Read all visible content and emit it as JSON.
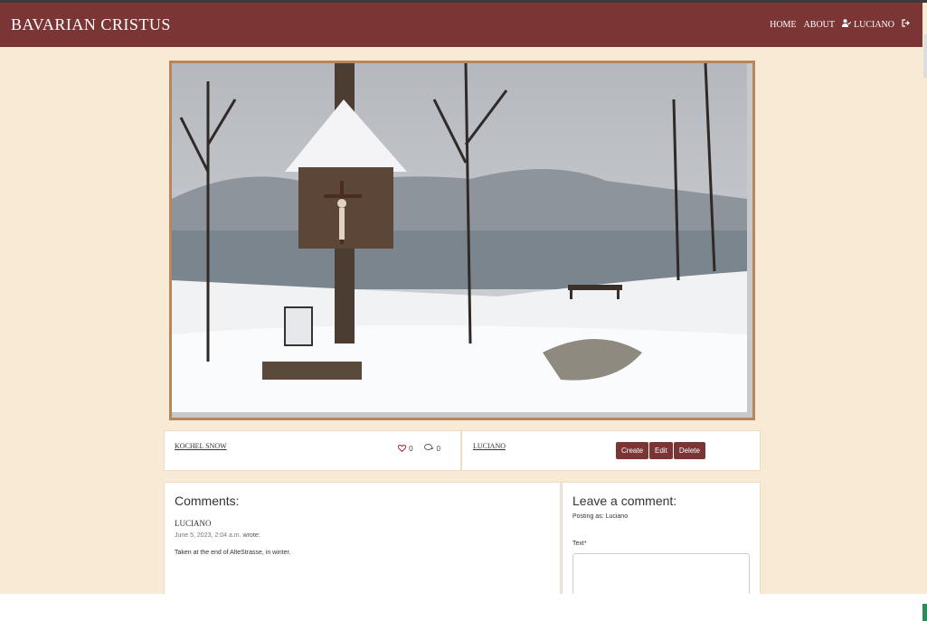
{
  "brand": "Bavarian Cristus",
  "nav": {
    "home": "Home",
    "about": "About",
    "user": "Luciano"
  },
  "post": {
    "title": "Kochel Snow",
    "likes": "0",
    "comments_count": "0",
    "author": "Luciano",
    "buttons": {
      "create": "Create",
      "edit": "Edit",
      "delete": "Delete"
    }
  },
  "comments": {
    "heading": "Comments:",
    "items": [
      {
        "author": "Luciano",
        "date": "June 5, 2023, 2:04 a.m.",
        "wrote": "wrote:",
        "text": "Taken at the end of AlteStrasse, in winter."
      }
    ]
  },
  "comment_form": {
    "heading": "Leave a comment:",
    "posting_as": "Posting as: Luciano",
    "text_label": "Text*"
  },
  "colors": {
    "primary": "#7b3535",
    "background": "#f9ead6",
    "frame": "#b9865b"
  },
  "icons": {
    "user": "user-check-icon",
    "logout": "sign-out-icon",
    "like": "heart-icon",
    "comment": "comments-icon"
  }
}
